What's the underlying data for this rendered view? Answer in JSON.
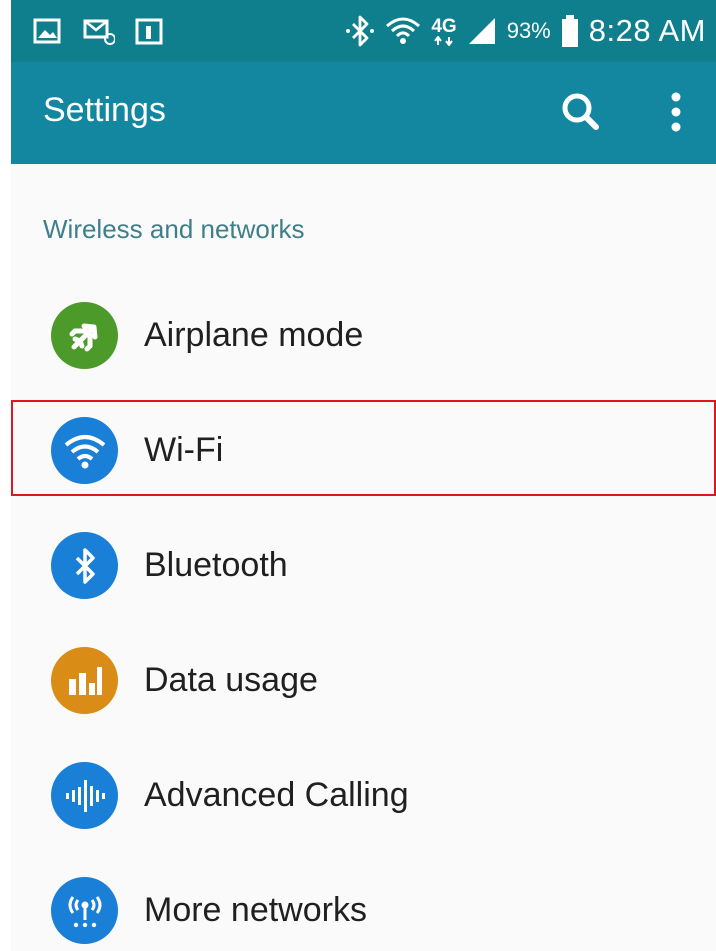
{
  "status_bar": {
    "left_icons": [
      "gallery-icon",
      "voicemail-icon",
      "calendar-icon"
    ],
    "right_icons": [
      "bluetooth-icon",
      "wifi-icon",
      "lte-4g-icon",
      "signal-icon",
      "battery-icon"
    ],
    "network_label": "4G",
    "battery_percent": "93%",
    "time": "8:28 AM"
  },
  "app_bar": {
    "title": "Settings",
    "actions": [
      "search-icon",
      "more-vert-icon"
    ]
  },
  "section": {
    "title": "Wireless and networks"
  },
  "items": [
    {
      "label": "Airplane mode",
      "icon": "airplane-icon",
      "color": "#4c9b2a"
    },
    {
      "label": "Wi-Fi",
      "icon": "wifi-icon",
      "color": "#1a7fd6"
    },
    {
      "label": "Bluetooth",
      "icon": "bluetooth-icon",
      "color": "#1a7fd6"
    },
    {
      "label": "Data usage",
      "icon": "data-usage-icon",
      "color": "#d98c16"
    },
    {
      "label": "Advanced Calling",
      "icon": "advanced-calling-icon",
      "color": "#1a7fd6"
    },
    {
      "label": "More networks",
      "icon": "more-networks-icon",
      "color": "#1a7fd6"
    }
  ],
  "colors": {
    "status_bar": "#0f7f8e",
    "app_bar": "#1487a0",
    "section_header": "#3e7f8a",
    "highlight": "#e0161d"
  }
}
